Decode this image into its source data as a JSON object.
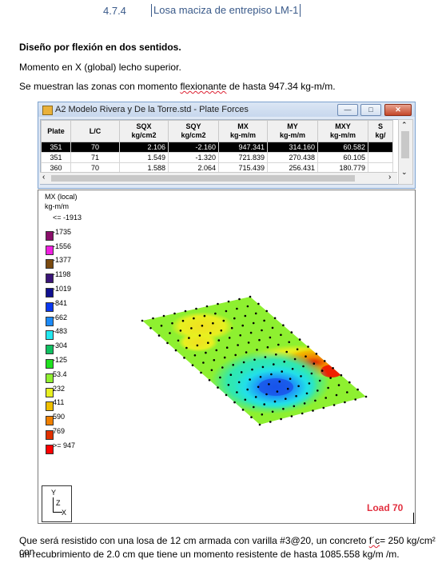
{
  "heading": {
    "number": "4.7.4",
    "title": "Losa maciza de entrepiso LM-1"
  },
  "body": {
    "p1": "Diseño por flexión en dos sentidos.",
    "p2": "Momento en X (global) lecho superior.",
    "p3a": "Se muestran las zonas con momento ",
    "p3b": "flexionante",
    "p3c": " de hasta 947.34 kg-m/m.",
    "p4a": "Que será resistido con una losa de 12 cm armada con varilla #3@20, un concreto ",
    "p4b": "f´c",
    "p4c": "= 250 kg/cm² con",
    "p5": "un recubrimiento de 2.0 cm que tiene un momento resistente de hasta 1085.558 kg/m /m."
  },
  "window": {
    "title": "A2 Modelo Rivera y De la Torre.std - Plate Forces",
    "buttons": {
      "minimize": "—",
      "maximize": "□",
      "close": "✕"
    },
    "columns": [
      {
        "h1": "Plate",
        "h2": ""
      },
      {
        "h1": "L/C",
        "h2": ""
      },
      {
        "h1": "SQX",
        "h2": "kg/cm2"
      },
      {
        "h1": "SQY",
        "h2": "kg/cm2"
      },
      {
        "h1": "MX",
        "h2": "kg-m/m"
      },
      {
        "h1": "MY",
        "h2": "kg-m/m"
      },
      {
        "h1": "MXY",
        "h2": "kg-m/m"
      },
      {
        "h1": "S",
        "h2": "kg/"
      }
    ],
    "rows": [
      [
        "351",
        "70",
        "2.106",
        "-2.160",
        "947.341",
        "314.160",
        "60.582",
        ""
      ],
      [
        "351",
        "71",
        "1.549",
        "-1.320",
        "721.839",
        "270.438",
        "60.105",
        ""
      ],
      [
        "360",
        "70",
        "1.588",
        "2.064",
        "715.439",
        "256.431",
        "180.779",
        ""
      ]
    ]
  },
  "plot": {
    "legend_title": "MX (local)",
    "legend_unit": "kg-m/m",
    "legend": [
      {
        "label": "<= -1913",
        "color": ""
      },
      {
        "label": "-1735",
        "color": "#8a0f6a"
      },
      {
        "label": "-1556",
        "color": "#f020e0"
      },
      {
        "label": "-1377",
        "color": "#7a4a10"
      },
      {
        "label": "-1198",
        "color": "#3a1478"
      },
      {
        "label": "-1019",
        "color": "#101090"
      },
      {
        "label": "-841",
        "color": "#0a38f0"
      },
      {
        "label": "-662",
        "color": "#1c8af8"
      },
      {
        "label": "-483",
        "color": "#22e8f0"
      },
      {
        "label": "-304",
        "color": "#10c060"
      },
      {
        "label": "-125",
        "color": "#20e020"
      },
      {
        "label": "53.4",
        "color": "#90f030"
      },
      {
        "label": "232",
        "color": "#e8f020"
      },
      {
        "label": "411",
        "color": "#f0c000"
      },
      {
        "label": "590",
        "color": "#f08000"
      },
      {
        "label": "769",
        "color": "#e03000"
      },
      {
        "label": ">= 947",
        "color": "#ff0000"
      }
    ],
    "axis_labels": {
      "y": "Y",
      "z": "Z",
      "x": "X"
    },
    "load_label": "Load 70"
  }
}
